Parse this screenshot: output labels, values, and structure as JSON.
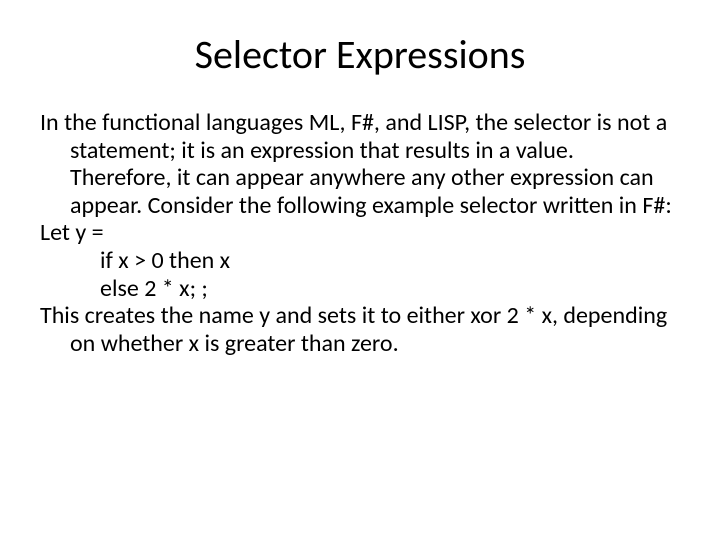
{
  "title": "Selector Expressions",
  "body": {
    "p1": "In the functional languages ML, F#, and LISP, the selector is not a statement; it is an expression that results in a value. Therefore, it can appear anywhere any other expression can appear. Consider the following example selector written in F#:",
    "p2": "Let y =",
    "c1": "if x > 0 then x",
    "c2": "else 2 * x; ;",
    "p3": "This creates the name y and sets it to either xor 2 * x, depending on whether x is greater than zero."
  }
}
